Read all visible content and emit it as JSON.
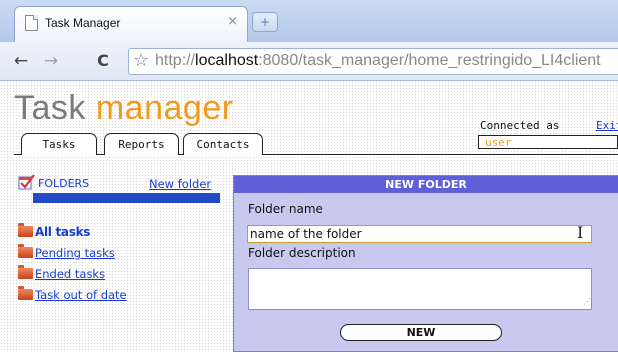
{
  "browser": {
    "tab_title": "Task Manager",
    "tab_close": "×",
    "new_tab": "+",
    "back": "←",
    "forward": "→",
    "reload": "C",
    "bookmark": "☆",
    "url_scheme": "http://",
    "url_host": "localhost",
    "url_rest": ":8080/task_manager/home_restringido_LI4client"
  },
  "app": {
    "logo_part1": "Task ",
    "logo_part2": "manager",
    "tabs": [
      "Tasks",
      "Reports",
      "Contacts"
    ],
    "connected_label": "Connected as",
    "exit_label": "Exit",
    "user": "user"
  },
  "sidebar": {
    "folders_title": "FOLDERS",
    "new_folder_link": "New folder",
    "items": [
      {
        "label": "All tasks",
        "active": true
      },
      {
        "label": "Pending tasks",
        "active": false
      },
      {
        "label": "Ended tasks",
        "active": false
      },
      {
        "label": "Task out of date",
        "active": false
      }
    ]
  },
  "panel": {
    "header": "NEW FOLDER",
    "name_label": "Folder name",
    "name_value": "name of the folder",
    "description_label": "Folder description",
    "description_value": "",
    "submit_label": "NEW"
  },
  "colors": {
    "logo_accent": "#f29a1d",
    "link": "#1a3bd1",
    "panel_header": "#5f5fd8",
    "panel_bg": "#c9c9ef"
  }
}
